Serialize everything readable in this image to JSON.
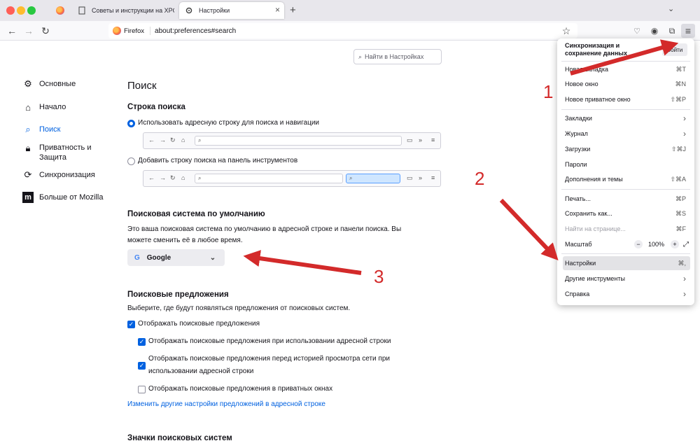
{
  "tabs": [
    {
      "title": ""
    },
    {
      "title": "Советы и инструкции на XPCC"
    },
    {
      "title": "Настройки"
    }
  ],
  "urlbar": {
    "identity": "Firefox",
    "url": "about:preferences#search"
  },
  "search_prefs_placeholder": "Найти в Настройках",
  "sidebar": [
    {
      "label": "Основные",
      "icon": "gear-icon"
    },
    {
      "label": "Начало",
      "icon": "home-icon"
    },
    {
      "label": "Поиск",
      "icon": "search-icon"
    },
    {
      "label": "Приватность и\nЗащита",
      "icon": "lock-icon"
    },
    {
      "label": "Синхронизация",
      "icon": "sync-icon"
    },
    {
      "label": "Больше от Mozilla",
      "icon": "mozilla-icon"
    }
  ],
  "main": {
    "title": "Поиск",
    "searchbar": {
      "heading": "Строка поиска",
      "option1": "Использовать адресную строку для поиска и навигации",
      "option2": "Добавить строку поиска на панель инструментов"
    },
    "default_engine": {
      "heading": "Поисковая система по умолчанию",
      "desc": "Это ваша поисковая система по умолчанию в адресной строке и панели поиска. Вы можете сменить её в любое время.",
      "value": "Google"
    },
    "suggestions": {
      "heading": "Поисковые предложения",
      "desc": "Выберите, где будут появляться предложения от поисковых систем.",
      "cb1": "Отображать поисковые предложения",
      "cb2": "Отображать поисковые предложения при использовании адресной строки",
      "cb3a": "Отображать поисковые предложения перед историей просмотра сети при",
      "cb3b": "использовании адресной строки",
      "cb4": "Отображать поисковые предложения в приватных окнах",
      "link": "Изменить другие настройки предложений в адресной строке"
    },
    "engines_heading": "Значки поисковых систем"
  },
  "menu": {
    "sync_line1": "Синхронизация и",
    "sync_line2": "сохранение данных",
    "sync_btn": "Войти",
    "items": [
      {
        "label": "Новая вкладка",
        "sc": "⌘T"
      },
      {
        "label": "Новое окно",
        "sc": "⌘N"
      },
      {
        "label": "Новое приватное окно",
        "sc": "⇧⌘P"
      },
      {
        "label": "Закладки",
        "sc": "›"
      },
      {
        "label": "Журнал",
        "sc": "›"
      },
      {
        "label": "Загрузки",
        "sc": "⇧⌘J"
      },
      {
        "label": "Пароли",
        "sc": ""
      },
      {
        "label": "Дополнения и темы",
        "sc": "⇧⌘A"
      },
      {
        "label": "Печать...",
        "sc": "⌘P"
      },
      {
        "label": "Сохранить как...",
        "sc": "⌘S"
      },
      {
        "label": "Найти на странице...",
        "sc": "⌘F"
      },
      {
        "label": "Масштаб",
        "sc": ""
      },
      {
        "label": "Настройки",
        "sc": "⌘,"
      },
      {
        "label": "Другие инструменты",
        "sc": "›"
      },
      {
        "label": "Справка",
        "sc": "›"
      }
    ],
    "zoom_value": "100%"
  },
  "annotations": [
    "1",
    "2",
    "3"
  ],
  "colors": {
    "accent": "#0061e0",
    "arrow": "#d32a2a"
  }
}
